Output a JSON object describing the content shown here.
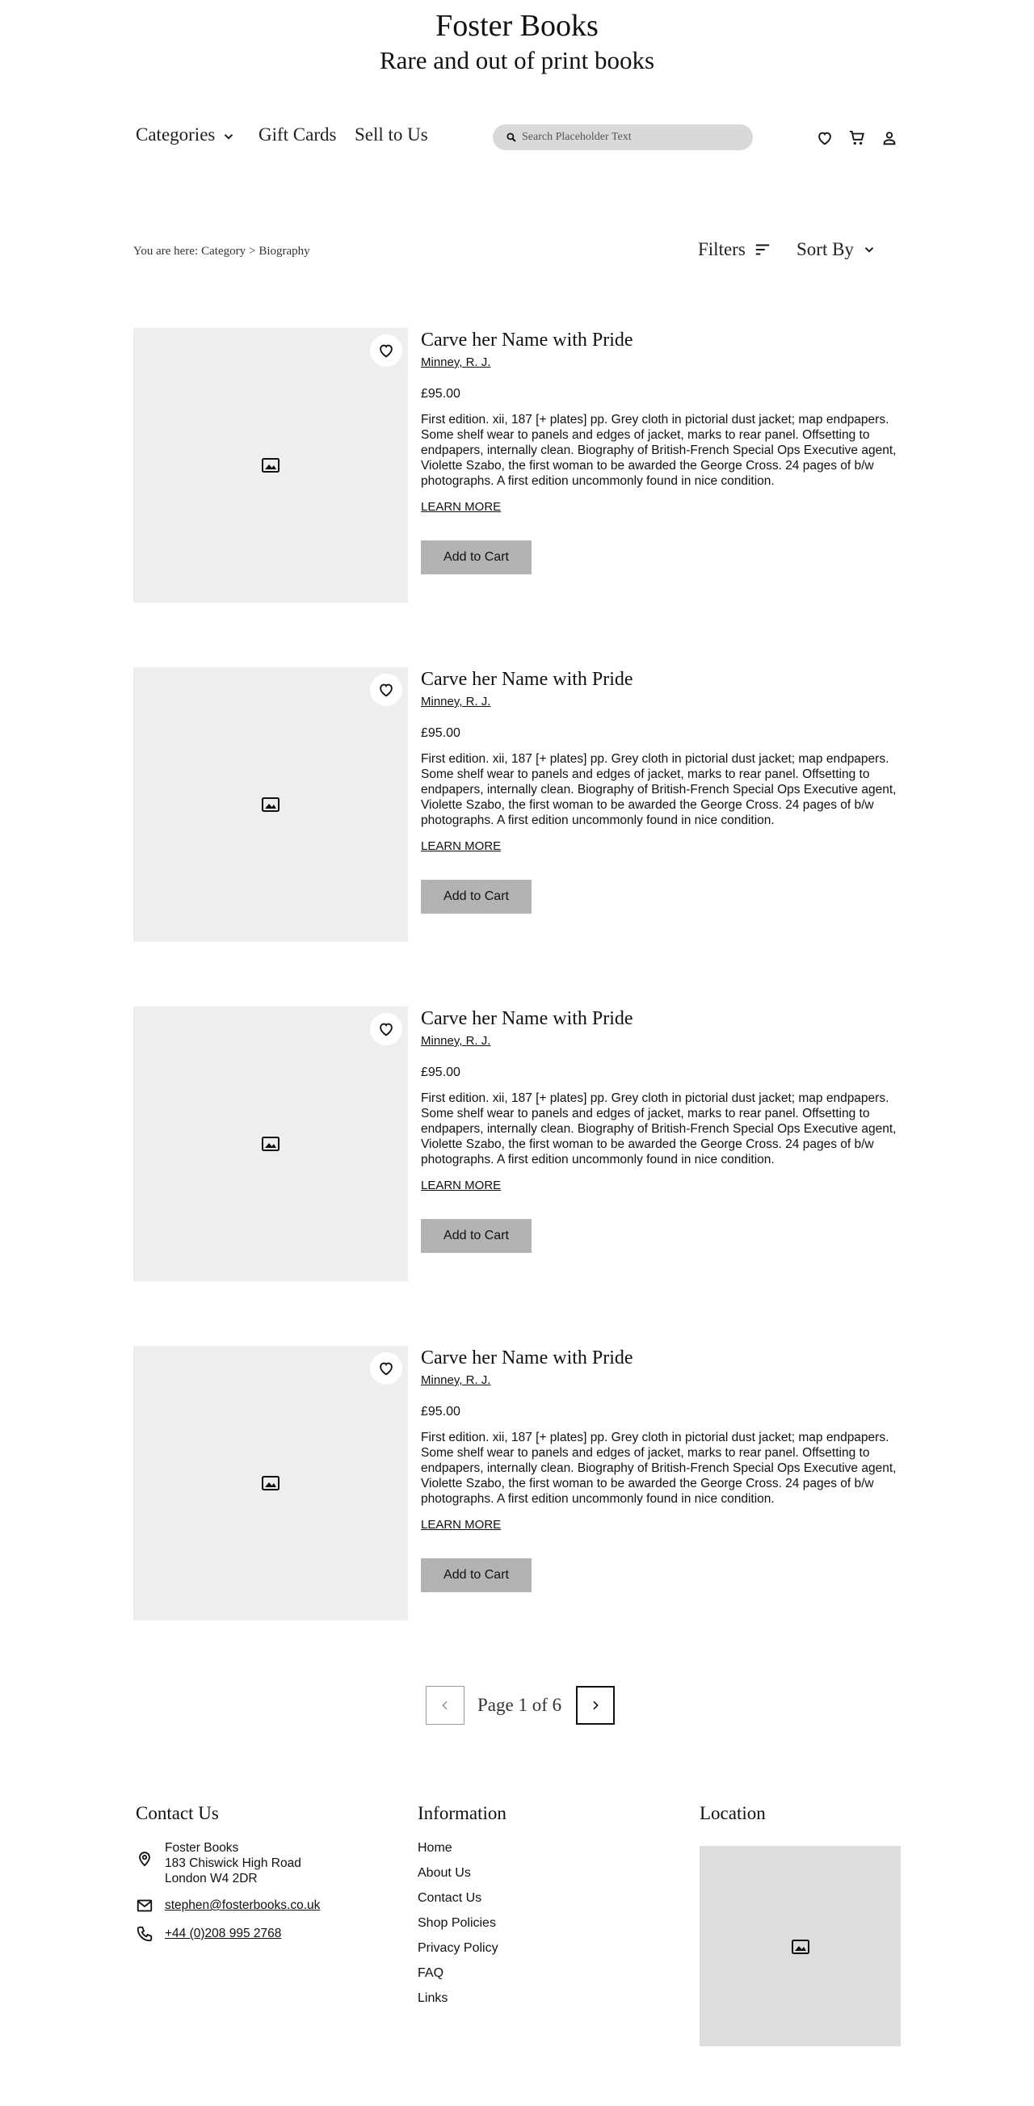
{
  "header": {
    "title": "Foster Books",
    "subtitle": "Rare and out of print books"
  },
  "nav": {
    "categories": "Categories",
    "gift_cards": "Gift Cards",
    "sell": "Sell to Us",
    "search_placeholder": "Search Placeholder Text"
  },
  "toolbar": {
    "breadcrumb_prefix": "You are here:",
    "breadcrumb_category": "Category",
    "breadcrumb_current": "> Biography",
    "filters": "Filters",
    "sort_by": "Sort By"
  },
  "products": [
    {
      "title": "Carve her Name with Pride",
      "author": "Minney, R. J.",
      "price": "£95.00",
      "description": "First edition. xii, 187 [+ plates] pp. Grey cloth in pictorial dust jacket; map endpapers. Some shelf wear to panels and edges of jacket, marks to rear panel. Offsetting to endpapers, internally clean. Biography of British-French Special Ops Executive agent, Violette Szabo, the first woman to be awarded the George Cross. 24 pages of b/w photographs. A first edition uncommonly found in nice condition.",
      "learn_more": "LEARN MORE",
      "add_to_cart": "Add to Cart"
    },
    {
      "title": "Carve her Name with Pride",
      "author": "Minney, R. J.",
      "price": "£95.00",
      "description": "First edition. xii, 187 [+ plates] pp. Grey cloth in pictorial dust jacket; map endpapers. Some shelf wear to panels and edges of jacket, marks to rear panel. Offsetting to endpapers, internally clean. Biography of British-French Special Ops Executive agent, Violette Szabo, the first woman to be awarded the George Cross. 24 pages of b/w photographs. A first edition uncommonly found in nice condition.",
      "learn_more": "LEARN MORE",
      "add_to_cart": "Add to Cart"
    },
    {
      "title": "Carve her Name with Pride",
      "author": "Minney, R. J.",
      "price": "£95.00",
      "description": "First edition. xii, 187 [+ plates] pp. Grey cloth in pictorial dust jacket; map endpapers. Some shelf wear to panels and edges of jacket, marks to rear panel. Offsetting to endpapers, internally clean. Biography of British-French Special Ops Executive agent, Violette Szabo, the first woman to be awarded the George Cross. 24 pages of b/w photographs. A first edition uncommonly found in nice condition.",
      "learn_more": "LEARN MORE",
      "add_to_cart": "Add to Cart"
    },
    {
      "title": "Carve her Name with Pride",
      "author": "Minney, R. J.",
      "price": "£95.00",
      "description": "First edition. xii, 187 [+ plates] pp. Grey cloth in pictorial dust jacket; map endpapers. Some shelf wear to panels and edges of jacket, marks to rear panel. Offsetting to endpapers, internally clean. Biography of British-French Special Ops Executive agent, Violette Szabo, the first woman to be awarded the George Cross. 24 pages of b/w photographs. A first edition uncommonly found in nice condition.",
      "learn_more": "LEARN MORE",
      "add_to_cart": "Add to Cart"
    }
  ],
  "pagination": {
    "label": "Page 1 of 6"
  },
  "footer": {
    "contact_heading": "Contact Us",
    "address_line1": "Foster Books",
    "address_line2": "183 Chiswick High Road",
    "address_line3": "London W4 2DR",
    "email": "stephen@fosterbooks.co.uk",
    "phone": "+44 (0)208 995 2768",
    "info_heading": "Information",
    "info_links": [
      "Home",
      "About Us",
      "Contact Us",
      "Shop Policies",
      "Privacy Policy",
      "FAQ",
      "Links"
    ],
    "location_heading": "Location"
  },
  "icons": {
    "nav": [
      "heart-icon",
      "cart-icon",
      "user-icon"
    ],
    "image_placeholder": "image-icon"
  },
  "colors": {
    "image_placeholder_bg": "#eeeeee",
    "search_bg": "#d9d9d9",
    "button_bg": "#b3b3b3"
  }
}
